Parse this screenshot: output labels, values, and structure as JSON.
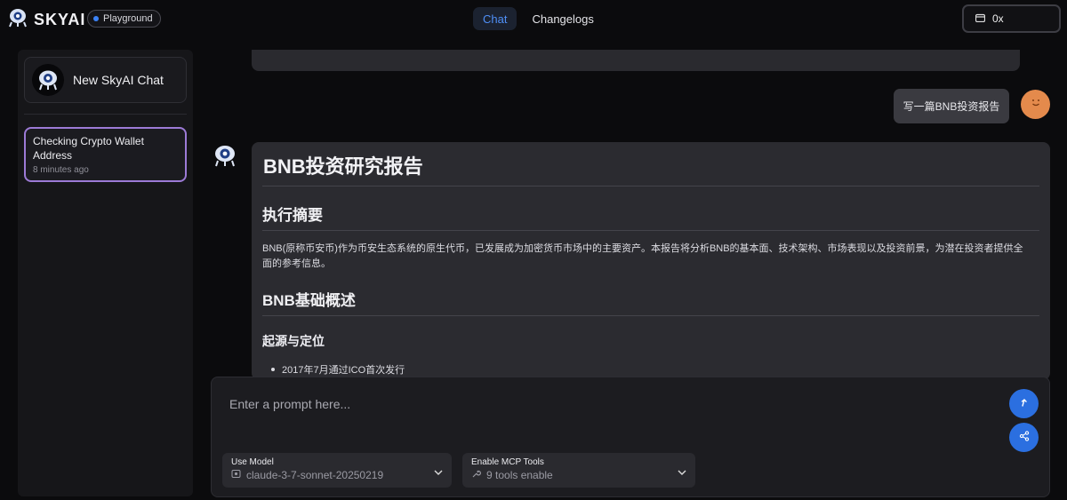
{
  "header": {
    "brand": "SKYAI",
    "badge": "Playground",
    "tabs": [
      {
        "label": "Chat",
        "active": true
      },
      {
        "label": "Changelogs",
        "active": false
      }
    ],
    "wallet_label": "0x"
  },
  "sidebar": {
    "new_chat_label": "New SkyAI Chat",
    "history": [
      {
        "title": "Checking Crypto Wallet Address",
        "time": "8 minutes ago"
      }
    ]
  },
  "conversation": {
    "user_message": "写一篇BNB投资报告",
    "assistant": {
      "title": "BNB投资研究报告",
      "section1_heading": "执行摘要",
      "section1_text": "BNB(原称币安币)作为币安生态系统的原生代币，已发展成为加密货币市场中的主要资产。本报告将分析BNB的基本面、技术架构、市场表现以及投资前景，为潜在投资者提供全面的参考信息。",
      "section2_heading": "BNB基础概述",
      "subsection_heading": "起源与定位",
      "bullets": [
        "2017年7月通过ICO首次发行"
      ]
    }
  },
  "composer": {
    "placeholder": "Enter a prompt here...",
    "model_label": "Use Model",
    "model_value": "claude-3-7-sonnet-20250219",
    "mcp_label": "Enable MCP Tools",
    "mcp_value": "9 tools enable"
  },
  "colors": {
    "accent_blue": "#2b6fe0",
    "active_tab_text": "#4f8ff7",
    "selected_border": "#9c7ad6",
    "user_avatar": "#e48a4c"
  }
}
